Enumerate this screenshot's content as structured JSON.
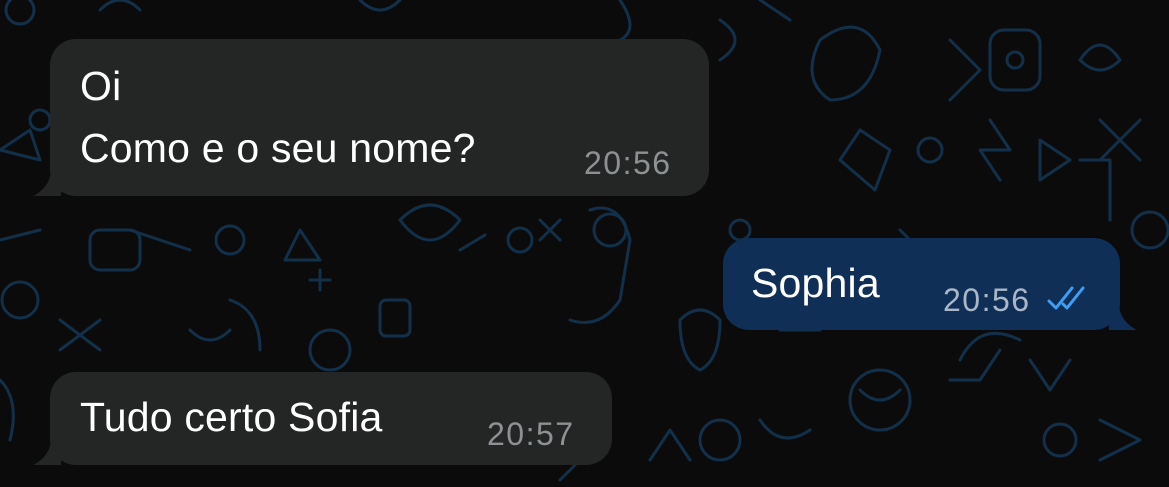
{
  "messages": [
    {
      "direction": "incoming",
      "lines": [
        "Oi",
        "Como e o seu nome?"
      ],
      "time": "20:56"
    },
    {
      "direction": "outgoing",
      "lines": [
        "Sophia"
      ],
      "time": "20:56",
      "status_icon": "double-check-read-icon"
    },
    {
      "direction": "incoming",
      "lines": [
        "Tudo certo Sofia"
      ],
      "time": "20:57"
    }
  ],
  "colors": {
    "background": "#0b0b0c",
    "wallpaper_doodle": "#123049",
    "incoming_bubble": "#242626",
    "outgoing_bubble": "#0f2f57",
    "timestamp": "#8e9193",
    "read_tick": "#3d9ff5",
    "text": "#ffffff"
  }
}
